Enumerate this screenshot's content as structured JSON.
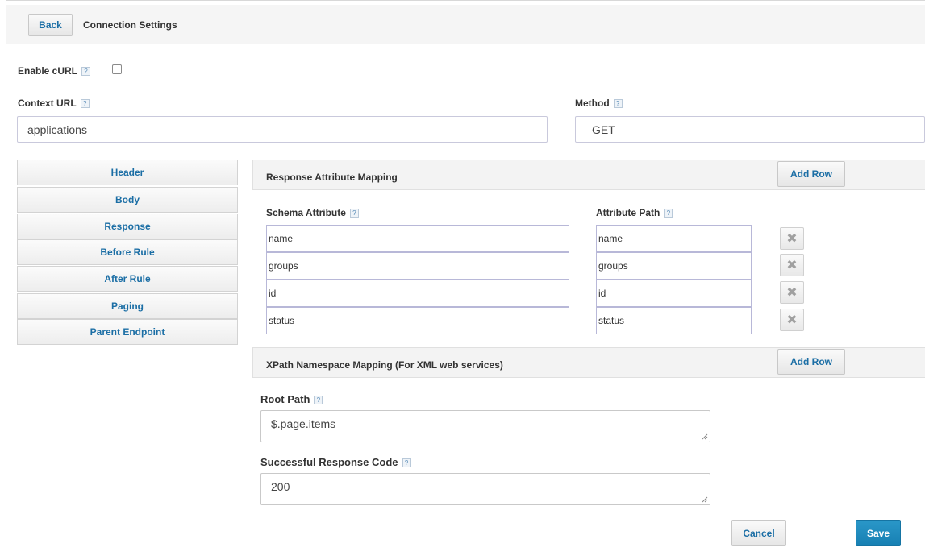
{
  "header": {
    "back_label": "Back",
    "title": "Connection Settings"
  },
  "enable_curl": {
    "label": "Enable cURL",
    "help": "?",
    "checked": false
  },
  "context_url": {
    "label": "Context URL",
    "help": "?",
    "value": "applications"
  },
  "method": {
    "label": "Method",
    "help": "?",
    "value": "GET"
  },
  "tabs": [
    {
      "label": "Header"
    },
    {
      "label": "Body"
    },
    {
      "label": "Response"
    },
    {
      "label": "Before Rule"
    },
    {
      "label": "After Rule"
    },
    {
      "label": "Paging"
    },
    {
      "label": "Parent Endpoint"
    }
  ],
  "response_mapping": {
    "title": "Response Attribute Mapping",
    "add_row_label": "Add Row",
    "schema_attribute_label": "Schema Attribute",
    "attribute_path_label": "Attribute Path",
    "help": "?",
    "rows": [
      {
        "schema": "name",
        "path": "name"
      },
      {
        "schema": "groups",
        "path": "groups"
      },
      {
        "schema": "id",
        "path": "id"
      },
      {
        "schema": "status",
        "path": "status"
      }
    ],
    "delete_glyph": "✖"
  },
  "xpath_mapping": {
    "title": "XPath Namespace Mapping (For XML web services)",
    "add_row_label": "Add Row"
  },
  "root_path": {
    "label": "Root Path",
    "help": "?",
    "value": "$.page.items"
  },
  "success_code": {
    "label": "Successful Response Code",
    "help": "?",
    "value": "200"
  },
  "footer": {
    "cancel_label": "Cancel",
    "save_label": "Save"
  }
}
